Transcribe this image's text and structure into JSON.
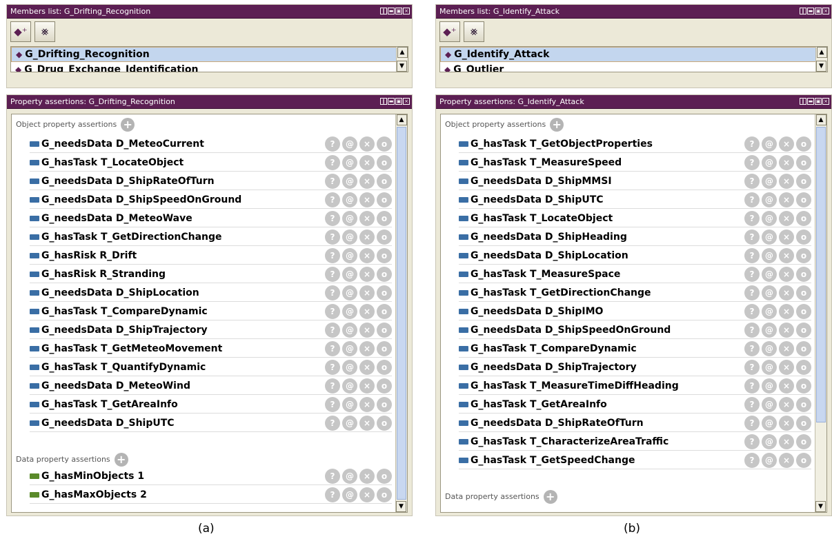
{
  "panels": [
    {
      "id": "a",
      "members": {
        "title": "Members list: G_Drifting_Recognition",
        "items": [
          "G_Drifting_Recognition",
          "G_Drug_Exchange_Identification"
        ]
      },
      "props": {
        "title": "Property assertions: G_Drifting_Recognition",
        "object_header": "Object property assertions",
        "object_rows": [
          "G_needsData  D_MeteoCurrent",
          "G_hasTask  T_LocateObject",
          "G_needsData  D_ShipRateOfTurn",
          "G_needsData  D_ShipSpeedOnGround",
          "G_needsData  D_MeteoWave",
          "G_hasTask  T_GetDirectionChange",
          "G_hasRisk  R_Drift",
          "G_hasRisk  R_Stranding",
          "G_needsData  D_ShipLocation",
          "G_hasTask  T_CompareDynamic",
          "G_needsData  D_ShipTrajectory",
          "G_hasTask  T_GetMeteoMovement",
          "G_hasTask  T_QuantifyDynamic",
          "G_needsData  D_MeteoWind",
          "G_hasTask  T_GetAreaInfo",
          "G_needsData  D_ShipUTC"
        ],
        "data_header": "Data property assertions",
        "data_rows": [
          "G_hasMinObjects  1",
          "G_hasMaxObjects  2"
        ]
      },
      "caption": "(a)"
    },
    {
      "id": "b",
      "members": {
        "title": "Members list: G_Identify_Attack",
        "items": [
          "G_Identify_Attack",
          "G_Outlier"
        ]
      },
      "props": {
        "title": "Property assertions: G_Identify_Attack",
        "object_header": "Object property assertions",
        "object_rows": [
          "G_hasTask  T_GetObjectProperties",
          "G_hasTask  T_MeasureSpeed",
          "G_needsData  D_ShipMMSI",
          "G_needsData  D_ShipUTC",
          "G_hasTask  T_LocateObject",
          "G_needsData  D_ShipHeading",
          "G_needsData  D_ShipLocation",
          "G_hasTask  T_MeasureSpace",
          "G_hasTask  T_GetDirectionChange",
          "G_needsData  D_ShipIMO",
          "G_needsData  D_ShipSpeedOnGround",
          "G_hasTask  T_CompareDynamic",
          "G_needsData  D_ShipTrajectory",
          "G_hasTask  T_MeasureTimeDiffHeading",
          "G_hasTask  T_GetAreaInfo",
          "G_needsData  D_ShipRateOfTurn",
          "G_hasTask  T_CharacterizeAreaTraffic",
          "G_hasTask  T_GetSpeedChange"
        ],
        "data_header": "Data property assertions",
        "data_rows": []
      },
      "caption": "(b)"
    }
  ],
  "toolbar": {
    "add_icon": "add-individual-icon",
    "delete_icon": "delete-individual-icon"
  },
  "row_actions": [
    "?",
    "@",
    "×",
    "o"
  ],
  "colors": {
    "titlebar": "#5c1f53",
    "selection": "#c3d6ee",
    "object_prop": "#3a6ea5",
    "data_prop": "#5a8a2a"
  }
}
